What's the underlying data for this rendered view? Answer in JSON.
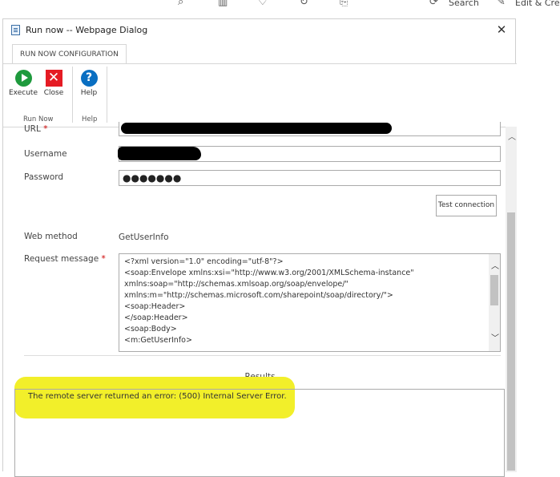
{
  "browser_toolbar": {
    "search_label": "Search",
    "edit_label": "Edit & Cre"
  },
  "dialog": {
    "title": "Run now -- Webpage Dialog",
    "close_glyph": "✕"
  },
  "ribbon": {
    "tab_label": "RUN NOW CONFIGURATION",
    "buttons": {
      "execute": "Execute",
      "close": "Close",
      "help": "Help"
    },
    "groups": {
      "run_now": "Run Now",
      "help": "Help"
    }
  },
  "form": {
    "url_label": "URL",
    "required_mark": "*",
    "username_label": "Username",
    "password_label": "Password",
    "password_value": "●●●●●●●",
    "test_connection_label": "Test connection",
    "web_method_label": "Web method",
    "web_method_value": "GetUserInfo",
    "request_message_label": "Request message",
    "request_lines": [
      "<?xml version=\"1.0\" encoding=\"utf-8\"?>",
      "<soap:Envelope xmlns:xsi=\"http://www.w3.org/2001/XMLSchema-instance\"",
      "xmlns:soap=\"http://schemas.xmlsoap.org/soap/envelope/\"",
      "xmlns:m=\"http://schemas.microsoft.com/sharepoint/soap/directory/\">",
      "<soap:Header>",
      "</soap:Header>",
      "<soap:Body>",
      "  <m:GetUserInfo>"
    ]
  },
  "results": {
    "title": "Results",
    "message": "The remote server returned an error: (500) Internal Server Error."
  },
  "colors": {
    "execute_green": "#1e9a3d",
    "close_red": "#e51b24",
    "help_blue": "#0a6fc2",
    "highlight_yellow": "#f2ef2a"
  }
}
